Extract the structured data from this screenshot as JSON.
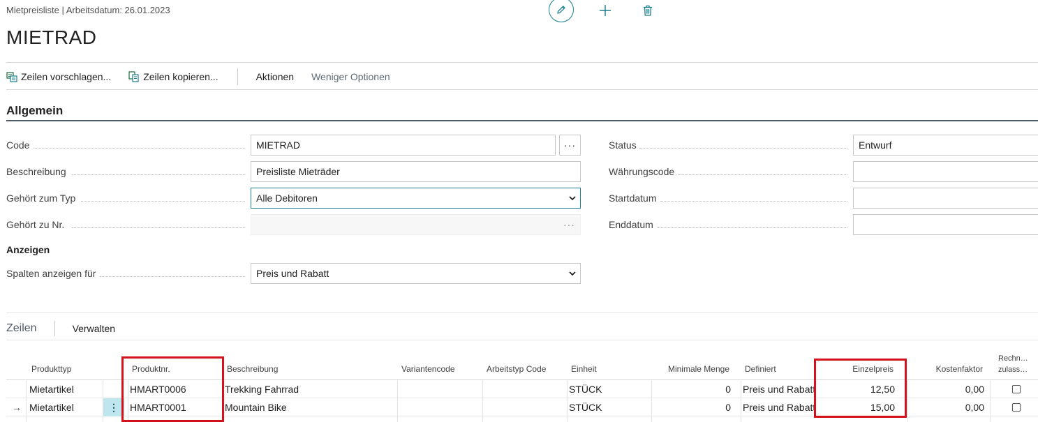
{
  "header": {
    "breadcrumb": "Mietpreisliste | Arbeitsdatum: 26.01.2023",
    "title": "MIETRAD"
  },
  "actions": {
    "suggest_lines": "Zeilen vorschlagen...",
    "copy_lines": "Zeilen kopieren...",
    "actions": "Aktionen",
    "fewer_options": "Weniger Optionen"
  },
  "general": {
    "section_title": "Allgemein",
    "code": {
      "label": "Code",
      "value": "MIETRAD",
      "lookup": "···"
    },
    "description": {
      "label": "Beschreibung",
      "value": "Preisliste Mieträder"
    },
    "assign_to_type": {
      "label": "Gehört zum Typ",
      "value": "Alle Debitoren"
    },
    "assign_to_no": {
      "label": "Gehört zu Nr.",
      "value": "",
      "lookup": "···"
    },
    "status": {
      "label": "Status",
      "value": "Entwurf"
    },
    "currency_code": {
      "label": "Währungscode",
      "value": ""
    },
    "start_date": {
      "label": "Startdatum",
      "value": ""
    },
    "end_date": {
      "label": "Enddatum",
      "value": ""
    },
    "view_heading": "Anzeigen",
    "view_columns_for": {
      "label": "Spalten anzeigen für",
      "value": "Preis und Rabatt"
    }
  },
  "lines": {
    "tab_active": "Zeilen",
    "tab_manage": "Verwalten",
    "columns": {
      "product_type": "Produkttyp",
      "product_no": "Produktnr.",
      "description": "Beschreibung",
      "variant_code": "Variantencode",
      "work_type_code": "Arbeitstyp Code",
      "unit": "Einheit",
      "min_qty": "Minimale Menge",
      "defines": "Definiert",
      "unit_price": "Einzelpreis",
      "cost_factor": "Kostenfaktor",
      "allow_invoice_disc_1": "Rechn…",
      "allow_invoice_disc_2": "zulass…"
    },
    "rows": [
      {
        "product_type": "Mietartikel",
        "product_no": "HMART0006",
        "description": "Trekking Fahrrad",
        "variant_code": "",
        "work_type_code": "",
        "unit": "STÜCK",
        "min_qty": "0",
        "defines": "Preis und Rabatt",
        "unit_price": "12,50",
        "cost_factor": "0,00"
      },
      {
        "product_type": "Mietartikel",
        "product_no": "HMART0001",
        "description": "Mountain Bike",
        "variant_code": "",
        "work_type_code": "",
        "unit": "STÜCK",
        "min_qty": "0",
        "defines": "Preis und Rabatt",
        "unit_price": "15,00",
        "cost_factor": "0,00",
        "current_marker": "→",
        "row_menu": "⋮"
      }
    ]
  },
  "colors": {
    "accent": "#1a7f8e",
    "highlight_box": "#d3121c",
    "selected_cell": "#bfe6ee"
  }
}
